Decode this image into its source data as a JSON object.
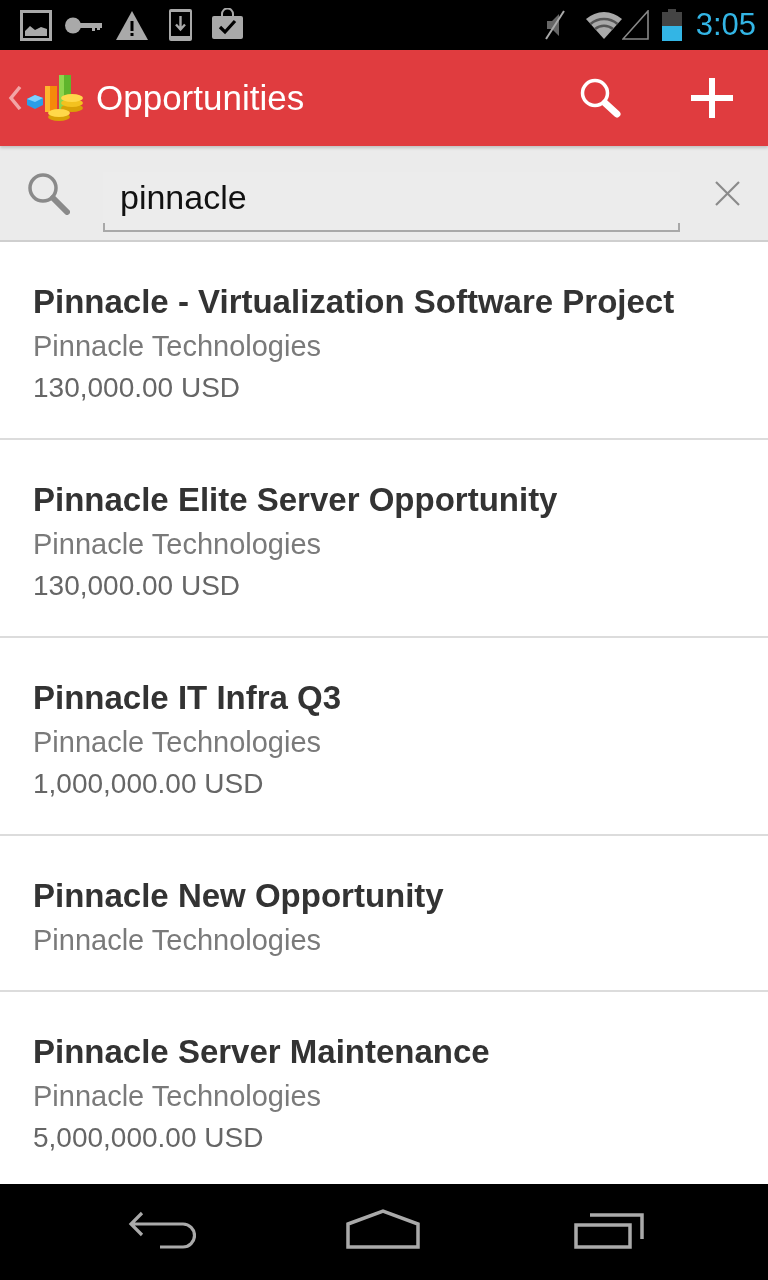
{
  "status_bar": {
    "time": "3:05"
  },
  "app_bar": {
    "title": "Opportunities"
  },
  "search": {
    "value": "pinnacle"
  },
  "opportunities": [
    {
      "title": "Pinnacle - Virtualization Software Project",
      "account": "Pinnacle Technologies",
      "amount": "130,000.00 USD"
    },
    {
      "title": "Pinnacle Elite Server Opportunity",
      "account": "Pinnacle Technologies",
      "amount": "130,000.00 USD"
    },
    {
      "title": "Pinnacle IT Infra Q3",
      "account": "Pinnacle Technologies",
      "amount": "1,000,000.00 USD"
    },
    {
      "title": "Pinnacle New Opportunity",
      "account": "Pinnacle Technologies"
    },
    {
      "title": "Pinnacle Server Maintenance",
      "account": "Pinnacle Technologies",
      "amount": "5,000,000.00 USD"
    }
  ]
}
